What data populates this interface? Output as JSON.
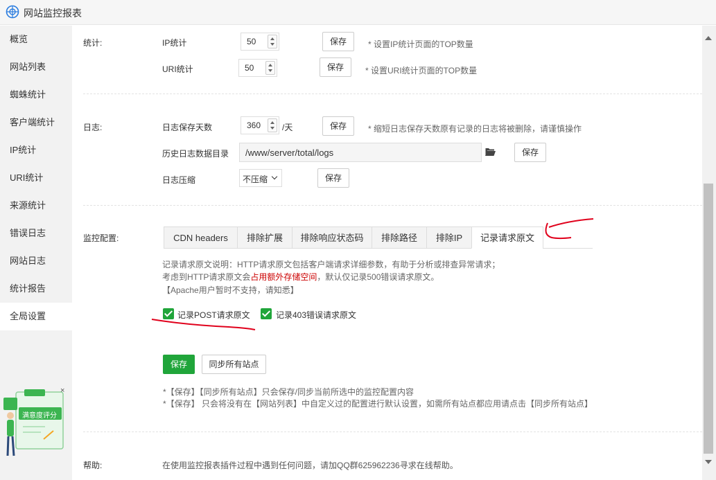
{
  "app": {
    "title": "网站监控报表"
  },
  "sidebar": {
    "items": [
      {
        "label": "概览"
      },
      {
        "label": "网站列表"
      },
      {
        "label": "蜘蛛统计"
      },
      {
        "label": "客户端统计"
      },
      {
        "label": "IP统计"
      },
      {
        "label": "URI统计"
      },
      {
        "label": "来源统计"
      },
      {
        "label": "错误日志"
      },
      {
        "label": "网站日志"
      },
      {
        "label": "统计报告"
      },
      {
        "label": "全局设置",
        "active": true
      }
    ],
    "rating_widget": {
      "label": "满意度评分",
      "close": "×"
    }
  },
  "stats": {
    "section_label": "统计:",
    "ip": {
      "label": "IP统计",
      "value": "50",
      "save": "保存",
      "hint": "* 设置IP统计页面的TOP数量"
    },
    "uri": {
      "label": "URI统计",
      "value": "50",
      "save": "保存",
      "hint": "* 设置URI统计页面的TOP数量"
    }
  },
  "log": {
    "section_label": "日志:",
    "retention": {
      "label": "日志保存天数",
      "value": "360",
      "unit": "/天",
      "save": "保存",
      "hint": "* 缩短日志保存天数原有记录的日志将被删除，请谨慎操作"
    },
    "history_dir": {
      "label": "历史日志数据目录",
      "value": "/www/server/total/logs",
      "save": "保存"
    },
    "compress": {
      "label": "日志压缩",
      "value": "不压缩",
      "save": "保存"
    }
  },
  "monitor": {
    "section_label": "监控配置:",
    "tabs": [
      "CDN headers",
      "排除扩展",
      "排除响应状态码",
      "排除路径",
      "排除IP",
      "记录请求原文"
    ],
    "active_tab": "记录请求原文",
    "desc_line1": "记录请求原文说明：HTTP请求原文包括客户端请求详细参数，有助于分析或排查异常请求；",
    "desc_line2_pre": "考虑到HTTP请求原文会",
    "desc_line2_warn": "占用额外存储空间",
    "desc_line2_post": "，默认仅记录500错误请求原文。",
    "desc_line3": "【Apache用户暂时不支持，请知悉】",
    "checkboxes": [
      {
        "label": "记录POST请求原文",
        "checked": true
      },
      {
        "label": "记录403错误请求原文",
        "checked": true
      }
    ],
    "save": "保存",
    "sync": "同步所有站点",
    "note1": "*【保存】【同步所有站点】只会保存/同步当前所选中的监控配置内容",
    "note2": "*【保存】 只会将没有在【网站列表】中自定义过的配置进行默认设置，如需所有站点都应用请点击【同步所有站点】"
  },
  "help": {
    "section_label": "帮助:",
    "text": "在使用监控报表插件过程中遇到任何问题，请加QQ群625962236寻求在线帮助。"
  },
  "colors": {
    "accent": "#20a53a",
    "warn": "#cc0000",
    "annotation": "#e0001b"
  }
}
